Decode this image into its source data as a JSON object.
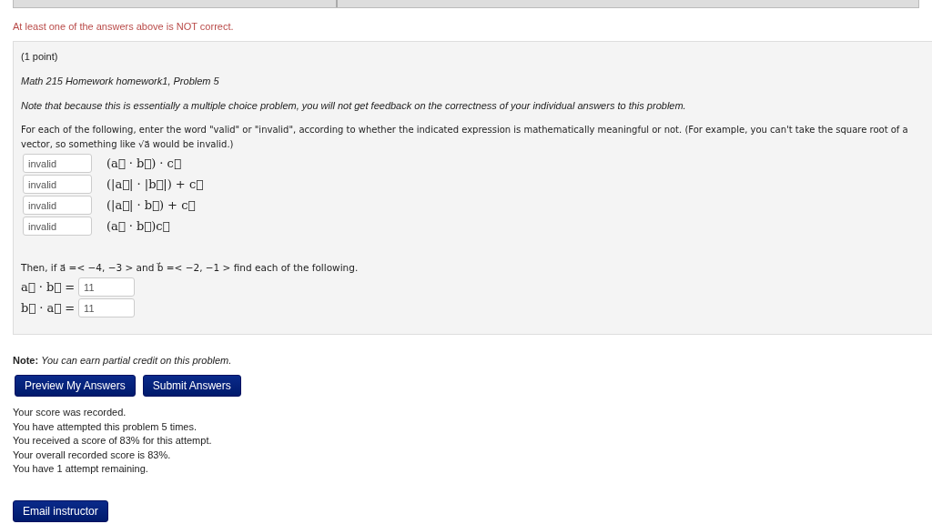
{
  "feedback_message": "At least one of the answers above is NOT correct.",
  "problem": {
    "points": "(1 point)",
    "title": "Math 215 Homework homework1, Problem 5",
    "note": "Note that because this is essentially a multiple choice problem, you will not get feedback on the correctness of your individual answers to this problem.",
    "instructions": "For each of the following, enter the word \"valid\" or \"invalid\", according to whether the indicated expression is mathematically meaningful or not. (For example, you can't take the square root of a vector, so something like √a⃗ would be invalid.)",
    "answers": [
      {
        "value": "invalid",
        "expression": "(a⃗ · b⃗) · c⃗"
      },
      {
        "value": "invalid",
        "expression": "(|a⃗| · |b⃗|) + c⃗"
      },
      {
        "value": "invalid",
        "expression": "(|a⃗| · b⃗) + c⃗"
      },
      {
        "value": "invalid",
        "expression": "(a⃗ · b⃗)c⃗"
      }
    ],
    "given": "Then, if a⃗ =< −4, −3 > and b⃗ =< −2, −1 > find each of the following.",
    "computations": [
      {
        "expression": "a⃗ · b⃗ =",
        "value": "11"
      },
      {
        "expression": "b⃗ · a⃗ =",
        "value": "11"
      }
    ]
  },
  "partial_credit": {
    "label": "Note:",
    "text": "You can earn partial credit on this problem."
  },
  "buttons": [
    "Preview My Answers",
    "Submit Answers"
  ],
  "score_messages": [
    "Your score was recorded.",
    "You have attempted this problem 5 times.",
    "You received a score of 83% for this attempt.",
    "Your overall recorded score is 83%.",
    "You have 1 attempt remaining."
  ],
  "email_button": "Email instructor"
}
